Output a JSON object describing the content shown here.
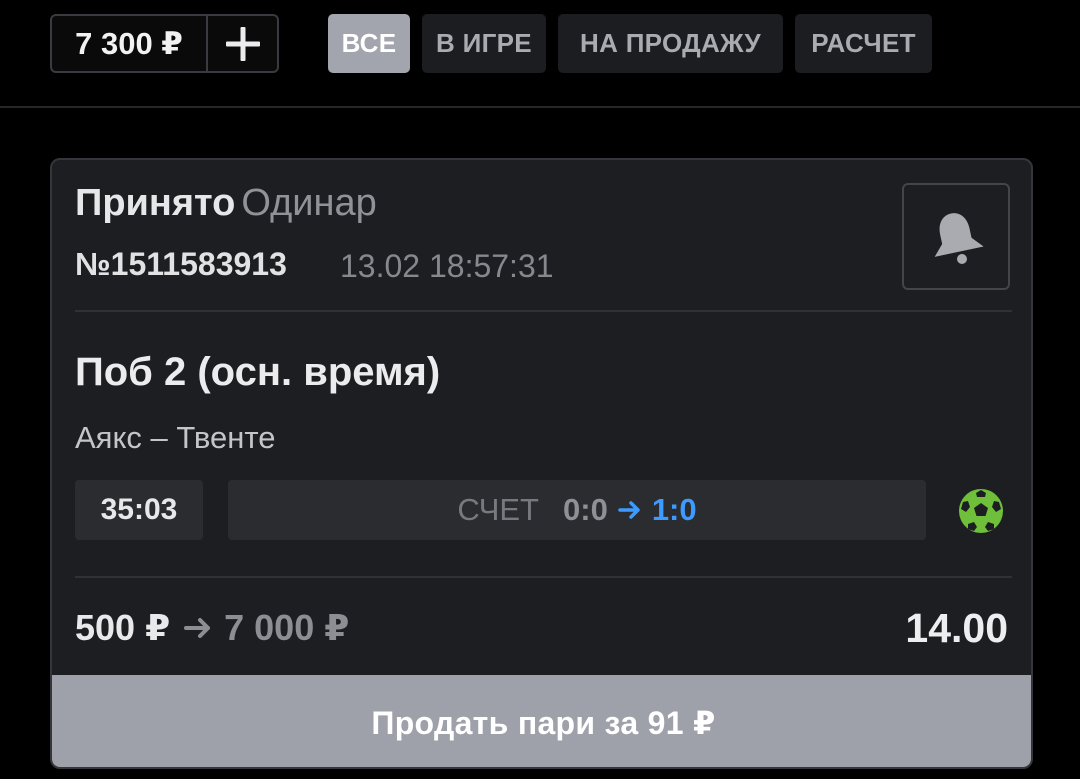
{
  "header": {
    "balance": "7 300 ₽",
    "tabs": [
      {
        "label": "ВСЕ",
        "active": true
      },
      {
        "label": "В ИГРЕ",
        "active": false
      },
      {
        "label": "НА ПРОДАЖУ",
        "active": false
      },
      {
        "label": "РАСЧЕТ",
        "active": false
      }
    ]
  },
  "bet": {
    "status": "Принято",
    "type": "Одинар",
    "number": "№1511583913",
    "datetime": "13.02 18:57:31",
    "market": "Поб 2 (осн. время)",
    "event": "Аякс – Твенте",
    "match_time": "35:03",
    "score_label": "СЧЕТ",
    "score_from": "0:0",
    "score_to": "1:0",
    "stake": "500 ₽",
    "potential_payout": "7 000 ₽",
    "odds": "14.00",
    "sell_label": "Продать пари за 91 ₽"
  },
  "icons": {
    "bell": "bell-icon",
    "plus": "plus-icon",
    "ball": "soccer-ball-icon",
    "arrow": "arrow-right-icon"
  },
  "colors": {
    "accent_blue": "#3d9bff",
    "ball_green": "#6fbf3a",
    "active_tab": "#a3a5ae"
  }
}
